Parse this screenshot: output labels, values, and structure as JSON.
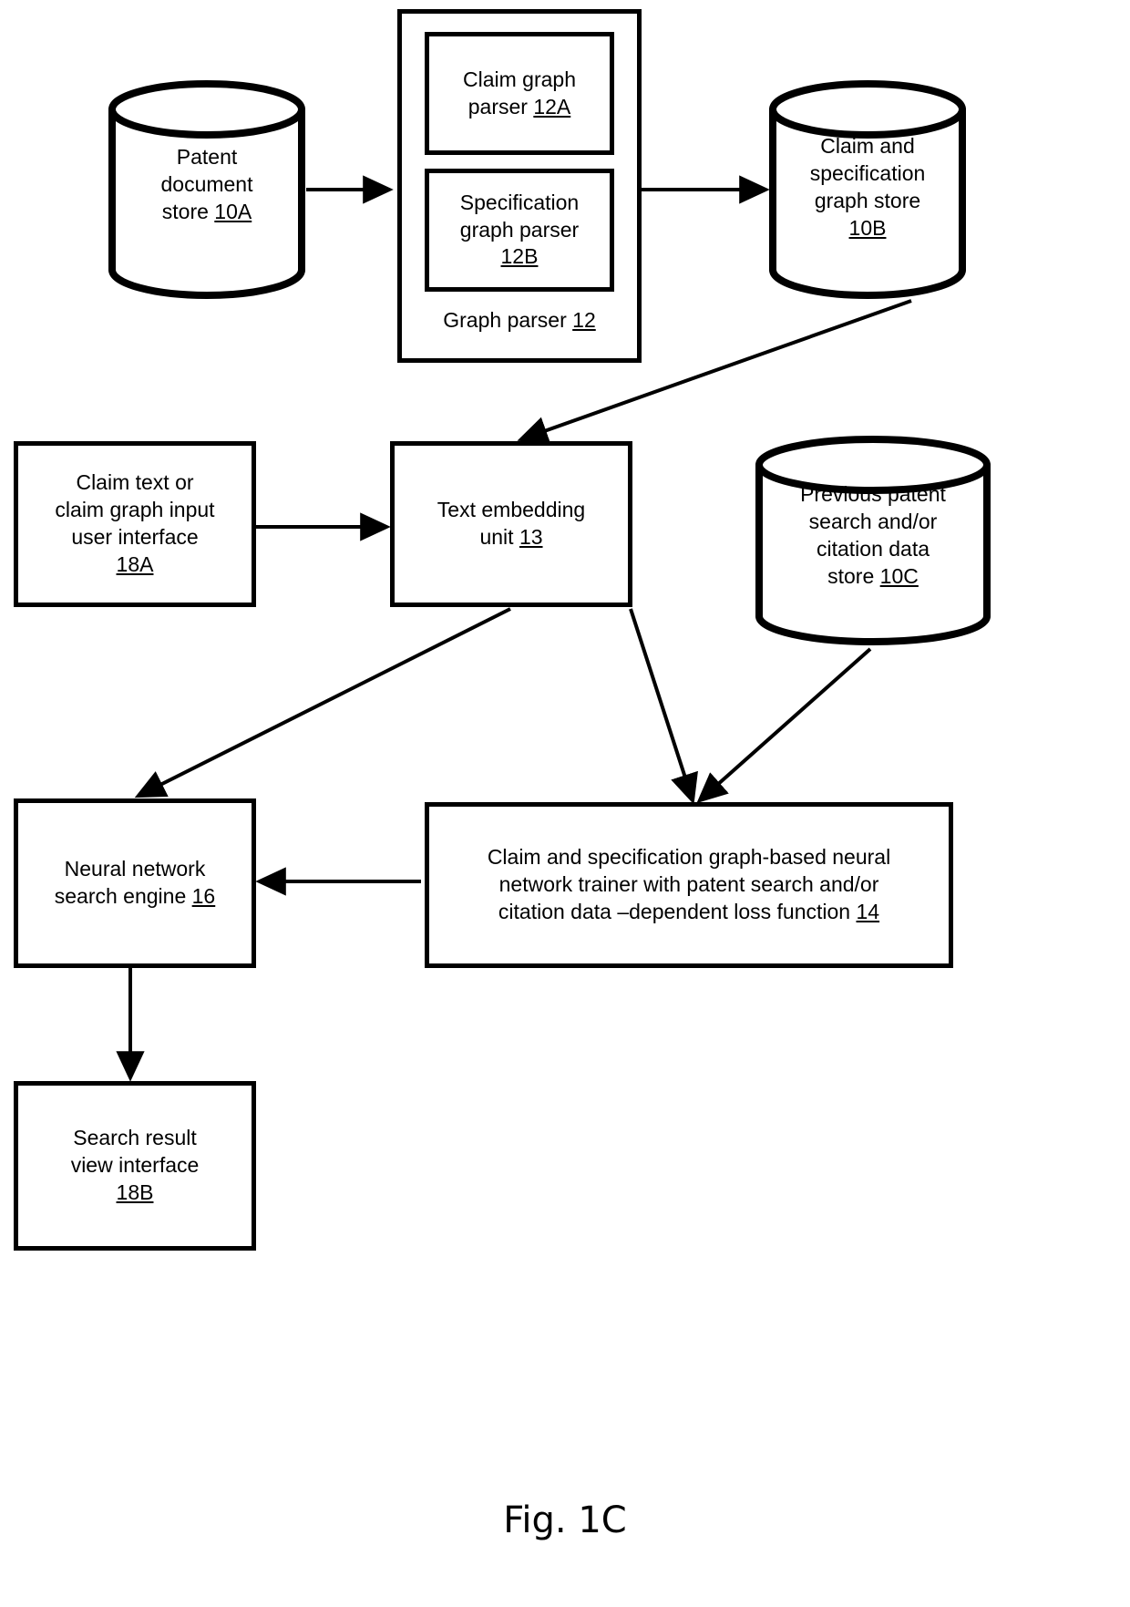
{
  "figure": {
    "caption": "Fig. 1C",
    "background_color": "#ffffff",
    "line_color": "#000000"
  },
  "nodes": {
    "patent_document_store": {
      "label": "Patent\ndocument\nstore ",
      "ref": "10A",
      "shape": "cylinder"
    },
    "graph_parser_group": {
      "label": "Graph parser ",
      "ref": "12",
      "shape": "rectangle"
    },
    "claim_graph_parser": {
      "label": "Claim graph\nparser ",
      "ref": "12A",
      "shape": "rectangle"
    },
    "specification_graph_parser": {
      "label": "Specification\ngraph parser\n",
      "ref": "12B",
      "shape": "rectangle"
    },
    "claim_and_specification_graph_store": {
      "label": "Claim and\nspecification\ngraph store\n",
      "ref": "10B",
      "shape": "cylinder"
    },
    "claim_input_user_interface": {
      "label": "Claim text or\nclaim graph input\nuser interface\n",
      "ref": "18A",
      "shape": "rectangle"
    },
    "text_embedding_unit": {
      "label": "Text embedding\nunit ",
      "ref": "13",
      "shape": "rectangle"
    },
    "previous_patent_search_store": {
      "label": "Previous patent\nsearch and/or\ncitation data\nstore ",
      "ref": "10C",
      "shape": "cylinder"
    },
    "neural_network_search_engine": {
      "label": "Neural network\nsearch engine ",
      "ref": "16",
      "shape": "rectangle"
    },
    "neural_network_trainer": {
      "label": "Claim and specification graph-based neural\nnetwork trainer with patent search and/or\ncitation data –dependent loss function ",
      "ref": "14",
      "shape": "rectangle"
    },
    "search_result_view_interface": {
      "label": "Search result\nview interface\n",
      "ref": "18B",
      "shape": "rectangle"
    }
  },
  "edges": [
    {
      "name": "patent-store-to-graph-parser",
      "from": "patent_document_store",
      "to": "graph_parser_group"
    },
    {
      "name": "graph-parser-to-graph-store",
      "from": "graph_parser_group",
      "to": "claim_and_specification_graph_store"
    },
    {
      "name": "graph-store-to-text-embedding",
      "from": "claim_and_specification_graph_store",
      "to": "text_embedding_unit"
    },
    {
      "name": "claim-input-to-text-embedding",
      "from": "claim_input_user_interface",
      "to": "text_embedding_unit"
    },
    {
      "name": "text-embedding-to-search-engine",
      "from": "text_embedding_unit",
      "to": "neural_network_search_engine"
    },
    {
      "name": "text-embedding-to-trainer",
      "from": "text_embedding_unit",
      "to": "neural_network_trainer"
    },
    {
      "name": "previous-search-store-to-trainer",
      "from": "previous_patent_search_store",
      "to": "neural_network_trainer"
    },
    {
      "name": "trainer-to-search-engine",
      "from": "neural_network_trainer",
      "to": "neural_network_search_engine"
    },
    {
      "name": "search-engine-to-result-view",
      "from": "neural_network_search_engine",
      "to": "search_result_view_interface"
    }
  ]
}
